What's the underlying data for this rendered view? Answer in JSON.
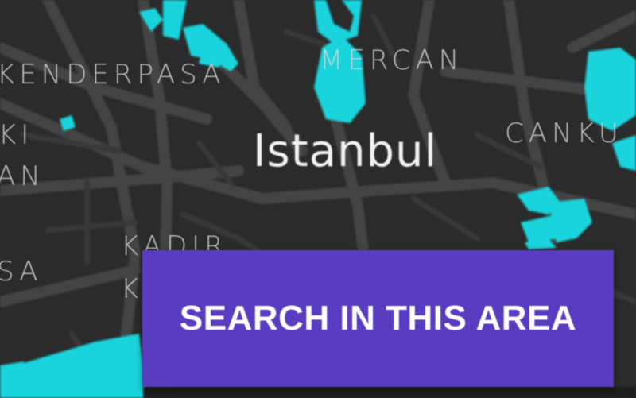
{
  "map": {
    "city_label": "Istanbul",
    "district_labels": {
      "mercan": "MERCAN",
      "iskenderpasa": "KENDERPASA",
      "cankurtaran": "CANKU",
      "kadirga_top": "KADIR",
      "kadirga_bottom": "K",
      "left_ki": "KI",
      "left_an": "AN",
      "left_sa": "SA"
    },
    "colors": {
      "background": "#2b2b2b",
      "roads": "#444444",
      "water_parks": "#19d4dc",
      "label": "#d6d6d6",
      "accent_button": "#5a3cc0"
    }
  },
  "search_button": {
    "label": "SEARCH IN THIS AREA"
  }
}
